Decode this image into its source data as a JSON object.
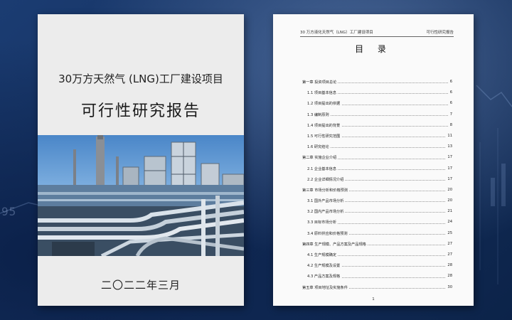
{
  "cover": {
    "title": "30万方天然气 (LNG)工厂建设项目",
    "subtitle": "可行性研究报告",
    "date": "二〇二二年三月"
  },
  "background": {
    "number_text": "95"
  },
  "toc": {
    "header_left": "30 万方液化天然气（LNG）工厂建设项目",
    "header_right": "可行性研究报告",
    "title": "目  录",
    "entries": [
      {
        "label": "第一章  投资项目总论",
        "page": "6"
      },
      {
        "label": "1.1 项目基本信息",
        "page": "6"
      },
      {
        "label": "1.2 项目提出的依据",
        "page": "6"
      },
      {
        "label": "1.3 编制原则",
        "page": "7"
      },
      {
        "label": "1.4 项目提出的背景",
        "page": "8"
      },
      {
        "label": "1.5 可行性研究范围",
        "page": "11"
      },
      {
        "label": "1.6 研究结论",
        "page": "13"
      },
      {
        "label": "第二章  实施企业介绍",
        "page": "17"
      },
      {
        "label": "2.1 企业基本信息",
        "page": "17"
      },
      {
        "label": "2.2 企业详细情况介绍",
        "page": "17"
      },
      {
        "label": "第三章  市场分析和价格预测",
        "page": "20"
      },
      {
        "label": "3.1 国外产品市场分析",
        "page": "20"
      },
      {
        "label": "3.2 国内产品市场分析",
        "page": "21"
      },
      {
        "label": "3.3 目标市场分析",
        "page": "24"
      },
      {
        "label": "3.4 原料供应和价格预测",
        "page": "25"
      },
      {
        "label": "第四章 生产规模、产品方案及产品规格",
        "page": "27"
      },
      {
        "label": "4.1 生产规模确定",
        "page": "27"
      },
      {
        "label": "4.2 生产规模及设置",
        "page": "28"
      },
      {
        "label": "4.3 产品方案及规格",
        "page": "28"
      },
      {
        "label": "第五章  项目地址及实施条件",
        "page": "30"
      }
    ],
    "page_number": "1"
  }
}
